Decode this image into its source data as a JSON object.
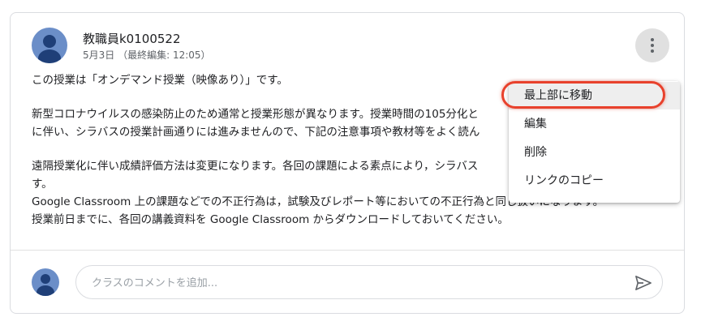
{
  "post": {
    "author": "教職員k0100522",
    "date": "5月3日 （最終編集: 12:05）",
    "body_lines": [
      "この授業は「オンデマンド授業（映像あり）」です。",
      "",
      "新型コロナウイルスの感染防止のため通常と授業形態が異なります。授業時間の105分化と",
      "に伴い、シラバスの授業計画通りには進みませんので、下記の注意事項や教材等をよく読ん",
      "",
      "遠隔授業化に伴い成績評価方法は変更になります。各回の課題による素点により，シラバス",
      "す。",
      "Google Classroom 上の課題などでの不正行為は，試験及びレポート等においての不正行為と同じ扱いになります。",
      "授業前日までに、各回の講義資料を Google Classroom からダウンロードしておいてください。"
    ]
  },
  "menu": {
    "items": [
      {
        "label": "最上部に移動",
        "active": true
      },
      {
        "label": "編集",
        "active": false
      },
      {
        "label": "削除",
        "active": false
      },
      {
        "label": "リンクのコピー",
        "active": false
      }
    ]
  },
  "comment": {
    "placeholder": "クラスのコメントを追加..."
  },
  "icons": {
    "more": "more-vert-icon",
    "send": "send-icon",
    "avatar": "person-avatar-icon"
  },
  "colors": {
    "avatar_bg": "#6b8ec8",
    "avatar_fg": "#1f3f78",
    "highlight": "#e8412c"
  }
}
